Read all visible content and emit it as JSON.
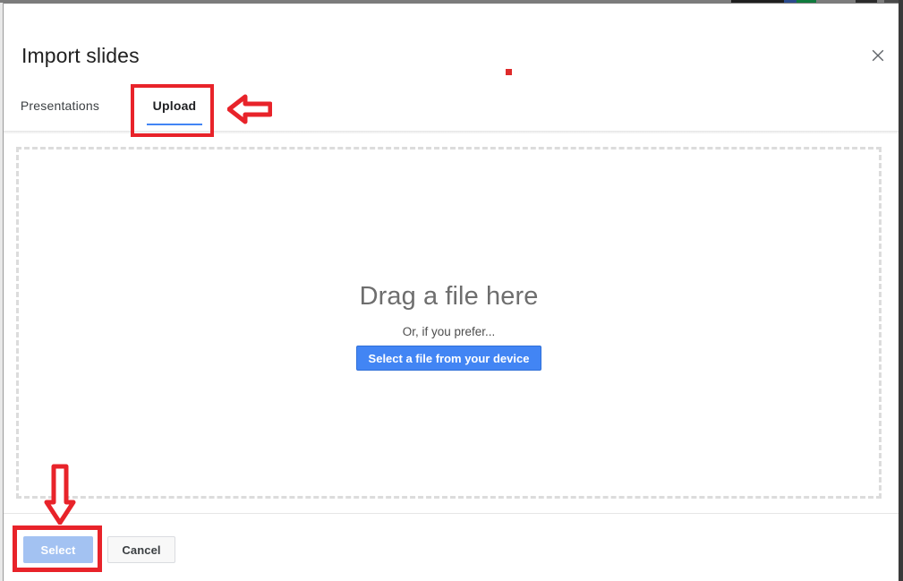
{
  "dialog": {
    "title": "Import slides",
    "close_icon": "close-x-icon",
    "tabs": [
      {
        "label": "Presentations",
        "active": false
      },
      {
        "label": "Upload",
        "active": true
      }
    ],
    "dropzone": {
      "main_text": "Drag a file here",
      "sub_text": "Or, if you prefer...",
      "pick_file_label": "Select a file from your device",
      "border_color": "#dcdcdc"
    },
    "footer": {
      "select_label": "Select",
      "select_color": "#a3c2f2",
      "cancel_label": "Cancel",
      "cancel_color": "#f8f8f8"
    },
    "accent_color": "#4285f4"
  },
  "annotations": {
    "color": "#e8232a",
    "highlight_upload_tab": "red-rectangle-around-upload-tab",
    "highlight_select_button": "red-rectangle-around-select-button",
    "arrow_to_upload_tab": "left-arrow-icon",
    "arrow_to_select_button": "down-arrow-icon",
    "marker_dot": "red-square-marker"
  }
}
